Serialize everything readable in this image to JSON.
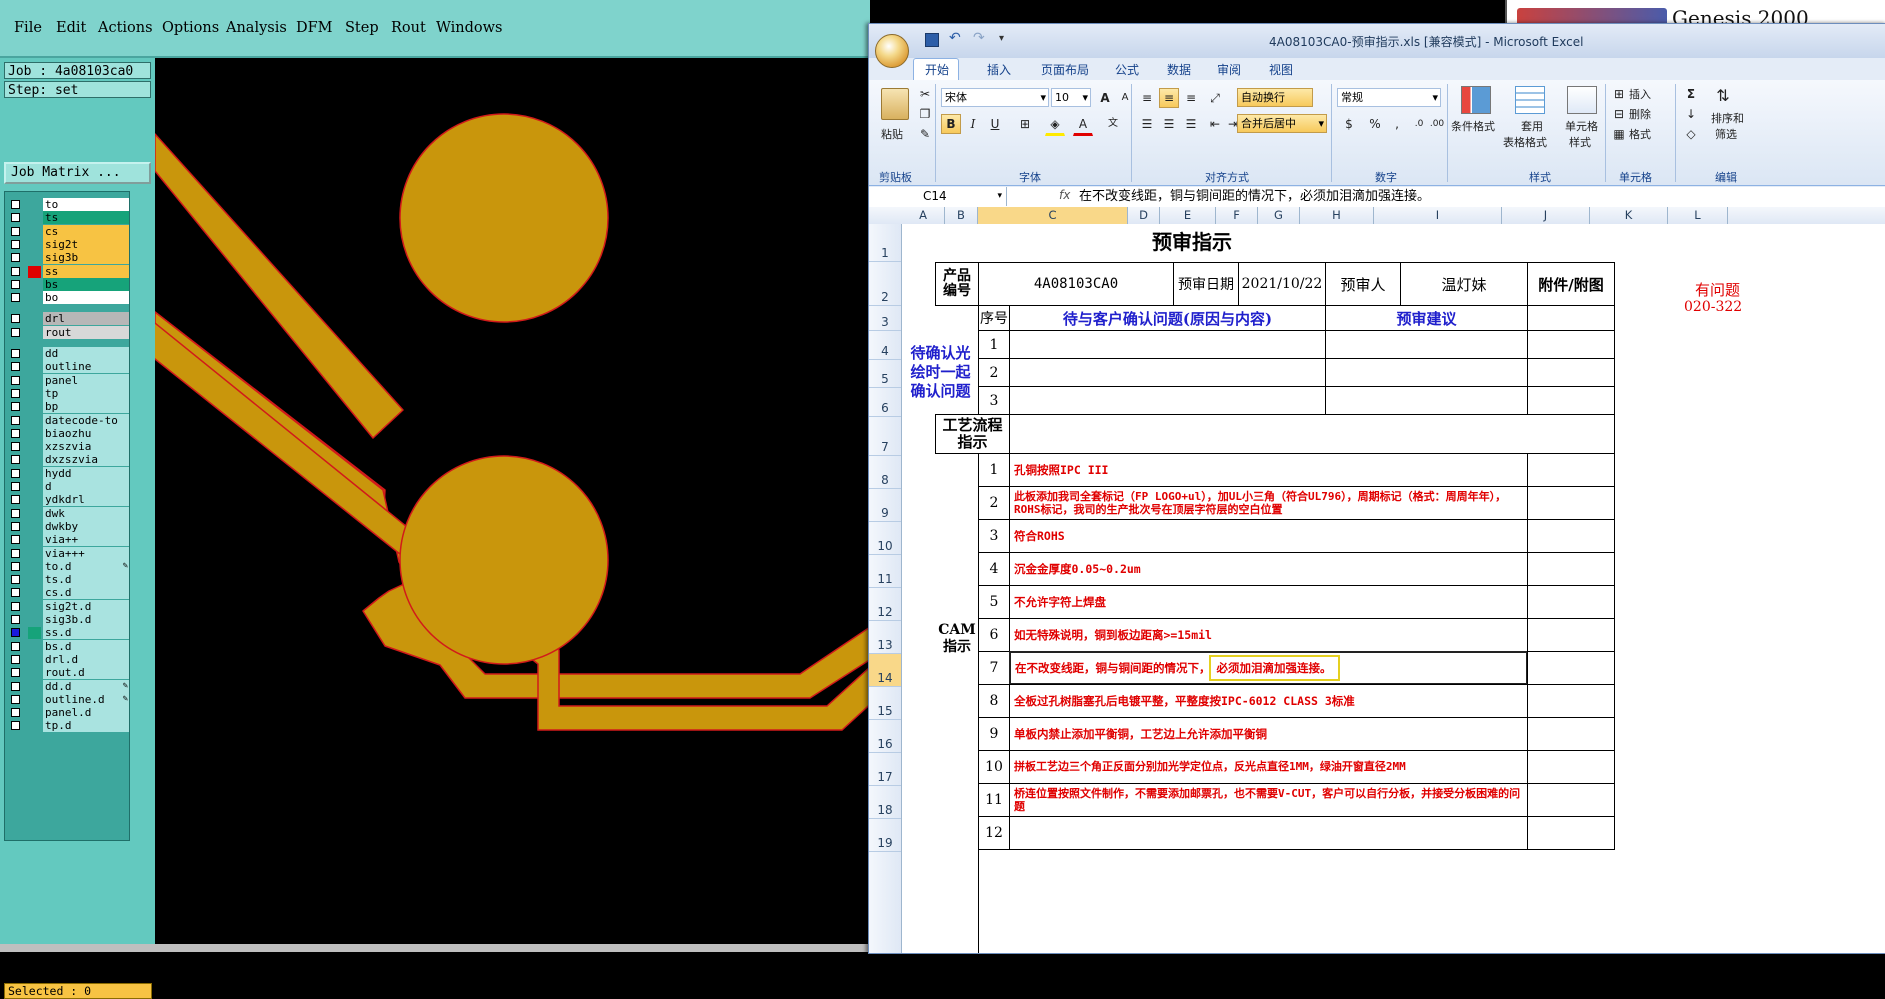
{
  "genesis": {
    "menu": [
      "File",
      "Edit",
      "Actions",
      "Options",
      "Analysis",
      "DFM",
      "Step",
      "Rout",
      "Windows"
    ],
    "job_label": "Job : 4a08103ca0",
    "step_label": "Step: set",
    "job_matrix_button": "Job Matrix ...",
    "selected_label": "Selected : 0",
    "title_text": "Genesis 2000",
    "layers": [
      {
        "name": "to",
        "color": "#ffffff"
      },
      {
        "name": "ts",
        "color": "#16a37a"
      },
      {
        "name": "cs",
        "color": "#f7c343"
      },
      {
        "name": "sig2t",
        "color": "#f7c343"
      },
      {
        "name": "sig3b",
        "color": "#f7c343"
      },
      {
        "name": "ss",
        "color": "#f7c343",
        "mark": "#e00000"
      },
      {
        "name": "bs",
        "color": "#16a37a"
      },
      {
        "name": "bo",
        "color": "#ffffff"
      },
      {
        "name": "drl",
        "color": "#b7b7b7",
        "gap": true
      },
      {
        "name": "rout",
        "color": "#d8d8d8"
      },
      {
        "name": "dd",
        "color": "#a9e3e0",
        "gap": true
      },
      {
        "name": "outline",
        "color": "#a9e3e0"
      },
      {
        "name": "panel",
        "color": "#a9e3e0"
      },
      {
        "name": "tp",
        "color": "#a9e3e0"
      },
      {
        "name": "bp",
        "color": "#a9e3e0"
      },
      {
        "name": "datecode-to",
        "color": "#a9e3e0"
      },
      {
        "name": "biaozhu",
        "color": "#a9e3e0"
      },
      {
        "name": "xzszvia",
        "color": "#a9e3e0"
      },
      {
        "name": "dxzszvia",
        "color": "#a9e3e0"
      },
      {
        "name": "hydd",
        "color": "#a9e3e0"
      },
      {
        "name": "d",
        "color": "#a9e3e0"
      },
      {
        "name": "ydkdrl",
        "color": "#a9e3e0"
      },
      {
        "name": "dwk",
        "color": "#a9e3e0"
      },
      {
        "name": "dwkby",
        "color": "#a9e3e0"
      },
      {
        "name": "via++",
        "color": "#a9e3e0"
      },
      {
        "name": "via+++",
        "color": "#a9e3e0"
      },
      {
        "name": "to.d",
        "color": "#a9e3e0",
        "pen": true
      },
      {
        "name": "ts.d",
        "color": "#a9e3e0"
      },
      {
        "name": "cs.d",
        "color": "#a9e3e0"
      },
      {
        "name": "sig2t.d",
        "color": "#a9e3e0"
      },
      {
        "name": "sig3b.d",
        "color": "#a9e3e0"
      },
      {
        "name": "ss.d",
        "color": "#a9e3e0",
        "mark": "#16a37a",
        "active": true
      },
      {
        "name": "bs.d",
        "color": "#a9e3e0"
      },
      {
        "name": "drl.d",
        "color": "#a9e3e0"
      },
      {
        "name": "rout.d",
        "color": "#a9e3e0"
      },
      {
        "name": "dd.d",
        "color": "#a9e3e0",
        "pen": true
      },
      {
        "name": "outline.d",
        "color": "#a9e3e0",
        "pen": true
      },
      {
        "name": "panel.d",
        "color": "#a9e3e0"
      },
      {
        "name": "tp.d",
        "color": "#a9e3e0"
      }
    ]
  },
  "excel": {
    "window_title": "4A08103CA0-预审指示.xls  [兼容模式] - Microsoft Excel",
    "ribbon_tabs": [
      "开始",
      "插入",
      "页面布局",
      "公式",
      "数据",
      "审阅",
      "视图"
    ],
    "ribbon": {
      "paste": "粘贴",
      "font_name": "宋体",
      "font_size": "10",
      "wrap_text": "自动换行",
      "merge_center": "合并后居中",
      "number_format": "常规",
      "cond_format": "条件格式",
      "table_format_1": "套用",
      "table_format_2": "表格格式",
      "cell_styles_1": "单元格",
      "cell_styles_2": "样式",
      "insert": "插入",
      "delete": "删除",
      "format": "格式",
      "sort_filter_1": "排序和",
      "sort_filter_2": "筛选",
      "groups": [
        "剪贴板",
        "字体",
        "对齐方式",
        "数字",
        "样式",
        "单元格",
        "编辑"
      ]
    },
    "name_box": "C14",
    "formula": "在不改变线距，铜与铜间距的情况下，必须加泪滴加强连接。",
    "columns": [
      "A",
      "B",
      "C",
      "D",
      "E",
      "F",
      "G",
      "H",
      "I",
      "J",
      "K",
      "L"
    ],
    "rows": [
      "1",
      "2",
      "3",
      "4",
      "5",
      "6",
      "7",
      "8",
      "9",
      "10",
      "11",
      "12",
      "13",
      "14",
      "15",
      "16",
      "17",
      "18",
      "19"
    ],
    "sheet": {
      "title": "预审指示",
      "product_no_label": "产品编号",
      "product_no": "4A08103CA0",
      "date_label": "预审日期",
      "date": "2021/10/22",
      "reviewer_label": "预审人",
      "reviewer": "温灯妹",
      "attachment_label": "附件/附图",
      "side_note_1": "有问题",
      "side_note_2": "020-322",
      "seq_label": "序号",
      "issues_header": "待与客户确认问题(原因与内容)",
      "suggest_header": "预审建议",
      "confirm_label": "待确认光绘时一起确认问题",
      "confirm_nums": [
        "1",
        "2",
        "3"
      ],
      "process_label": "工艺流程指示",
      "cam_label": "CAM指示",
      "cam_items": [
        {
          "n": "1",
          "text": "孔铜按照IPC III"
        },
        {
          "n": "2",
          "text": "此板添加我司全套标记（FP LOGO+ul），加UL小三角（符合UL796），周期标记（格式：周周年年），ROHS标记，我司的生产批次号在顶层字符层的空白位置"
        },
        {
          "n": "3",
          "text": "符合ROHS"
        },
        {
          "n": "4",
          "text": "沉金金厚度0.05~0.2um"
        },
        {
          "n": "5",
          "text": "不允许字符上焊盘"
        },
        {
          "n": "6",
          "text": "如无特殊说明，铜到板边距离>=15mil"
        },
        {
          "n": "7",
          "text_a": "在不改变线距，铜与铜间距的情况下，",
          "text_b": "必须加泪滴加强连接。"
        },
        {
          "n": "8",
          "text": "全板过孔树脂塞孔后电镀平整，平整度按IPC-6012 CLASS 3标准"
        },
        {
          "n": "9",
          "text": "单板内禁止添加平衡铜，工艺边上允许添加平衡铜"
        },
        {
          "n": "10",
          "text": "拼板工艺边三个角正反面分别加光学定位点，反光点直径1MM，绿油开窗直径2MM"
        },
        {
          "n": "11",
          "text": "桥连位置按照文件制作，不需要添加邮票孔，也不需要V-CUT，客户可以自行分板，并接受分板困难的问题"
        },
        {
          "n": "12",
          "text": ""
        }
      ]
    }
  },
  "colors": {
    "copper": "#c9960c",
    "copper_outline": "#d11a1a",
    "genesis_bg": "#63c9bf",
    "excel_blue_text": "#1f1fcc",
    "excel_red_text": "#e00000"
  }
}
